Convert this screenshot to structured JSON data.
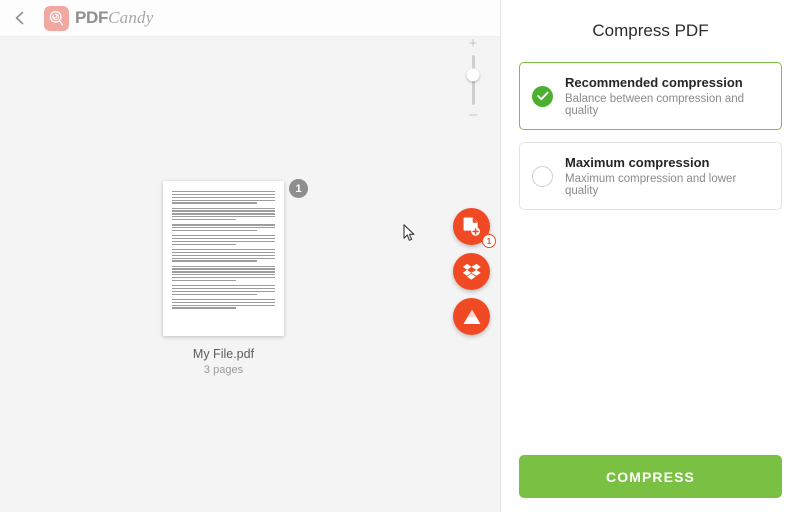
{
  "header": {
    "back_icon": "chevron-left-icon",
    "logo_icon": "lollipop-icon",
    "logo_primary": "PDF",
    "logo_secondary": "Candy"
  },
  "workspace": {
    "zoom": {
      "increase_label": "+",
      "decrease_label": "–",
      "handle_position_percent": 40
    },
    "file": {
      "page_badge": "1",
      "name": "My File.pdf",
      "pages": "3 pages"
    },
    "actions": [
      {
        "name": "add-file",
        "icon": "file-plus-icon",
        "badge": "1"
      },
      {
        "name": "dropbox",
        "icon": "dropbox-icon",
        "badge": ""
      },
      {
        "name": "google-drive",
        "icon": "google-drive-icon",
        "badge": ""
      }
    ],
    "cursor_icon": "mouse-pointer-icon"
  },
  "sidebar": {
    "title": "Compress PDF",
    "options": [
      {
        "title": "Recommended compression",
        "subtitle": "Balance between compression and quality",
        "selected": true
      },
      {
        "title": "Maximum compression",
        "subtitle": "Maximum compression and lower quality",
        "selected": false
      }
    ],
    "submit_label": "COMPRESS"
  },
  "colors": {
    "accent_orange": "#ef4a23",
    "accent_green": "#7ac143",
    "radio_green": "#4caf2f",
    "panel_bg": "#f4f4f4",
    "logo_pink": "#f0a8a0"
  }
}
